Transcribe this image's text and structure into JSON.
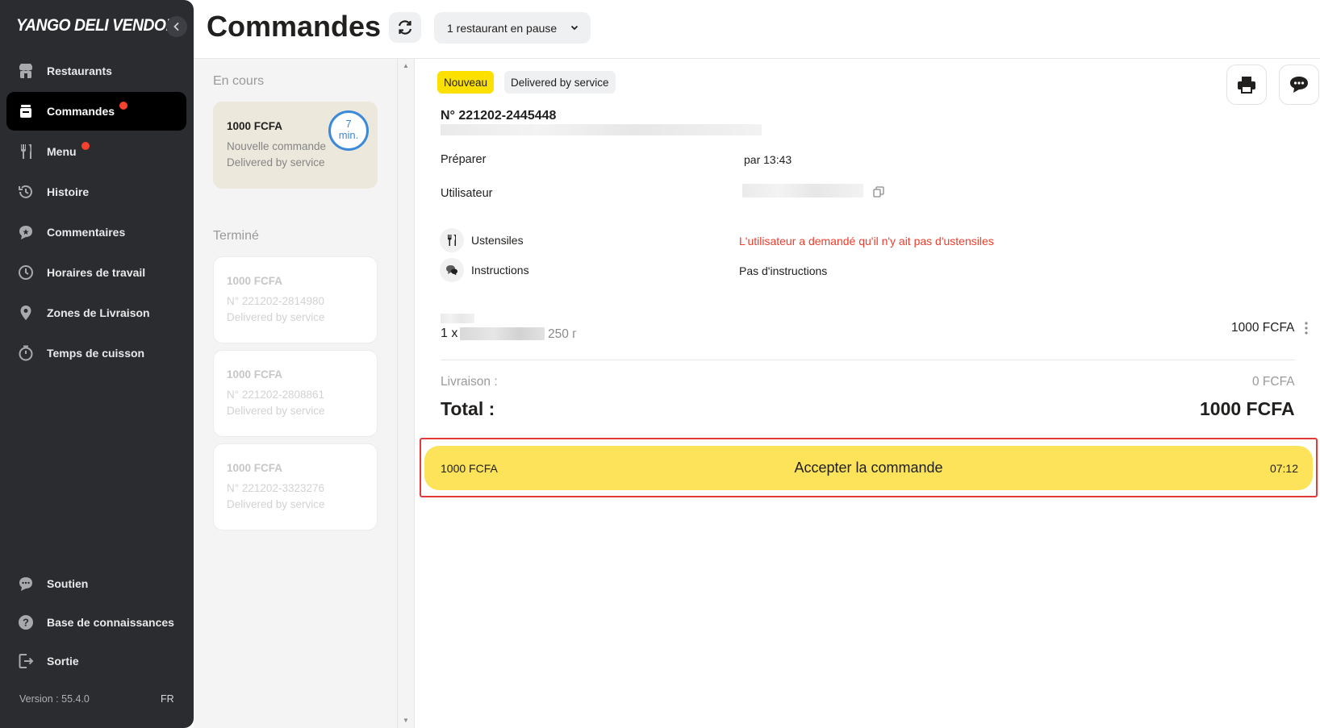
{
  "sidebar": {
    "logo": "YANGO DELI VENDOR",
    "items": [
      {
        "label": "Restaurants",
        "icon": "store-icon",
        "dot": false
      },
      {
        "label": "Commandes",
        "icon": "orders-icon",
        "dot": true
      },
      {
        "label": "Menu",
        "icon": "fork-knife-icon",
        "dot": true
      },
      {
        "label": "Histoire",
        "icon": "history-icon",
        "dot": false
      },
      {
        "label": "Commentaires",
        "icon": "comment-icon",
        "dot": false
      },
      {
        "label": "Horaires de travail",
        "icon": "clock-icon",
        "dot": false
      },
      {
        "label": "Zones de Livraison",
        "icon": "location-pin-icon",
        "dot": false
      },
      {
        "label": "Temps de cuisson",
        "icon": "stopwatch-icon",
        "dot": false
      }
    ],
    "bottom": [
      {
        "label": "Soutien",
        "icon": "chat-bubble-icon"
      },
      {
        "label": "Base de connaissances",
        "icon": "help-icon"
      },
      {
        "label": "Sortie",
        "icon": "exit-icon"
      }
    ],
    "version": "Version : 55.4.0",
    "lang": "FR"
  },
  "header": {
    "title": "Commandes",
    "pause_select": "1 restaurant en pause"
  },
  "orders": {
    "in_progress_title": "En cours",
    "active": {
      "price": "1000 FCFA",
      "line2": "Nouvelle commande",
      "line3": "Delivered by service",
      "timer_value": "7",
      "timer_unit": "min."
    },
    "done_title": "Terminé",
    "done": [
      {
        "price": "1000 FCFA",
        "number": "N° 221202-2814980",
        "service": "Delivered by service"
      },
      {
        "price": "1000 FCFA",
        "number": "N° 221202-2808861",
        "service": "Delivered by service"
      },
      {
        "price": "1000 FCFA",
        "number": "N° 221202-3323276",
        "service": "Delivered by service"
      }
    ]
  },
  "detail": {
    "badge_new": "Nouveau",
    "badge_service": "Delivered by service",
    "order_number": "N° 221202-2445448",
    "prepare_label": "Préparer",
    "prepare_value": "par 13:43",
    "user_label": "Utilisateur",
    "utensils_label": "Ustensiles",
    "utensils_value": "L'utilisateur a demandé qu'il n'y ait pas d'ustensiles",
    "instructions_label": "Instructions",
    "instructions_value": "Pas d'instructions",
    "item_qty": "1 x",
    "item_weight": "250 г",
    "item_price": "1000 FCFA",
    "delivery_label": "Livraison :",
    "delivery_value": "0 FCFA",
    "total_label": "Total :",
    "total_value": "1000 FCFA",
    "accept_price": "1000 FCFA",
    "accept_label": "Accepter la commande",
    "accept_time": "07:12"
  },
  "colors": {
    "sidebar_bg": "#2b2c30",
    "accent_yellow": "#fce000",
    "notification_dot": "#f5412d",
    "warning_red": "#f03c2a",
    "timer_blue": "#3b8ad9"
  }
}
